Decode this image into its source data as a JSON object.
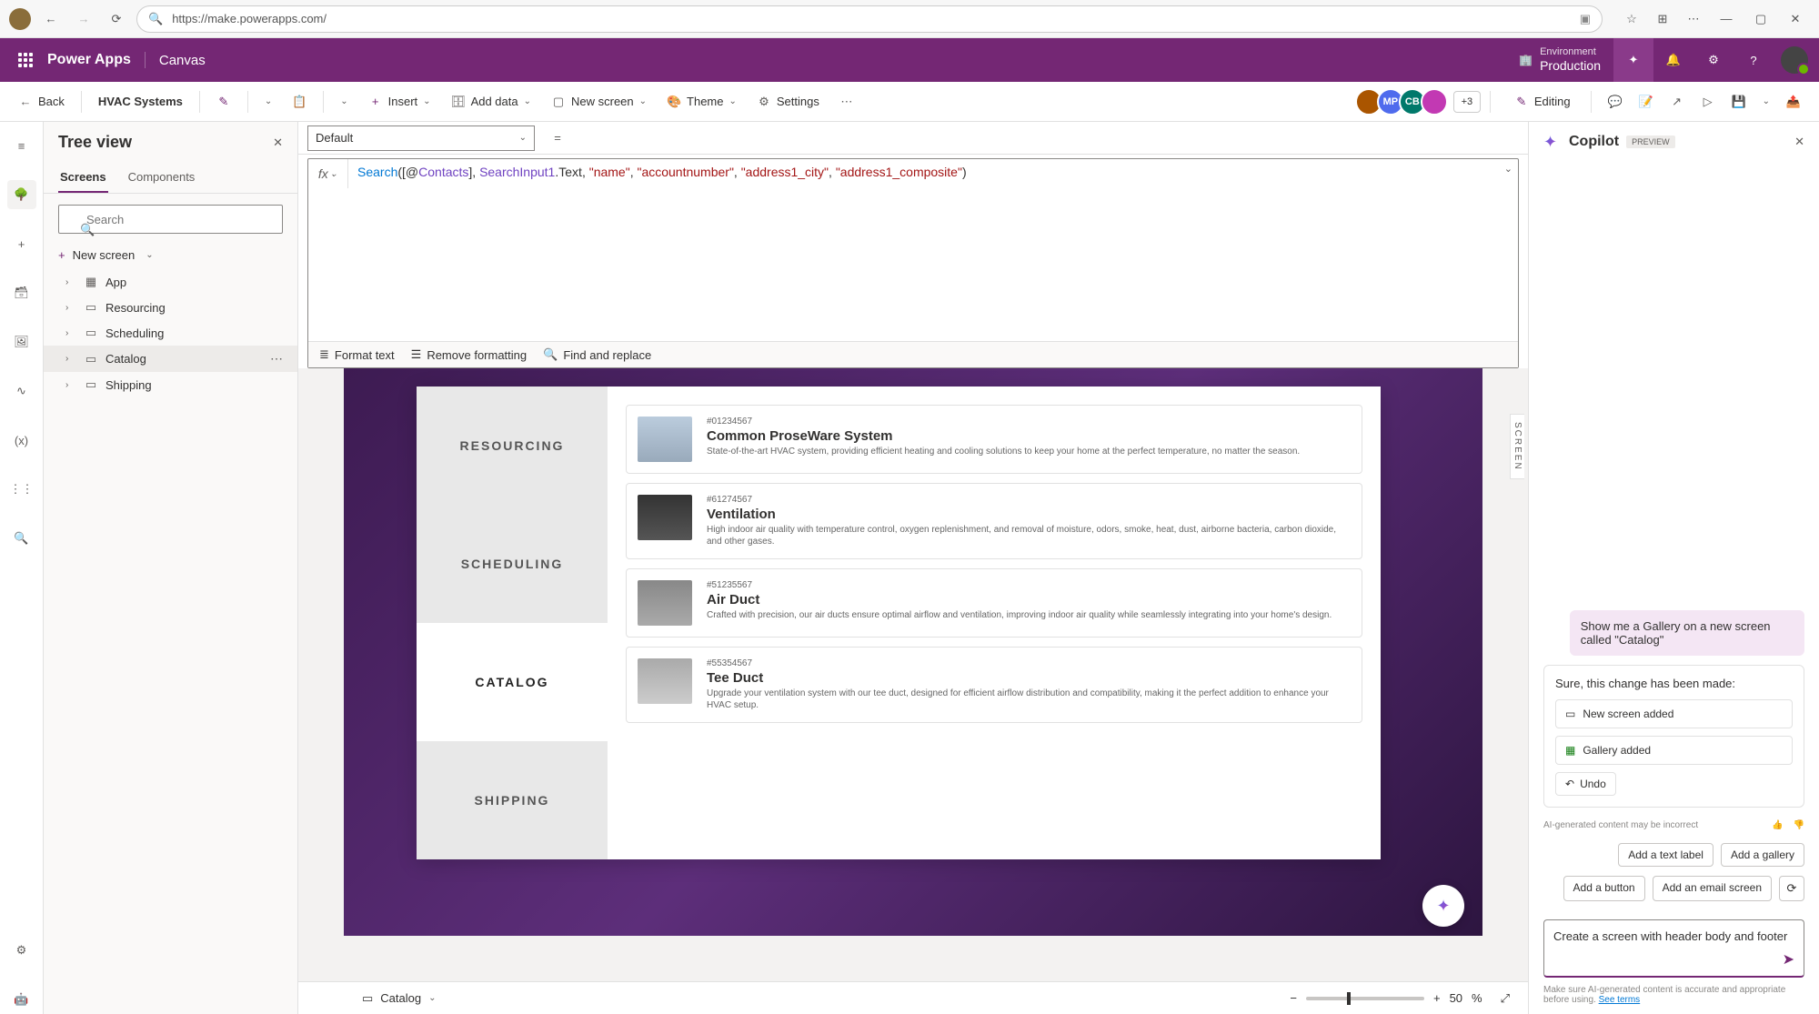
{
  "browser": {
    "url": "https://make.powerapps.com/"
  },
  "appbar": {
    "brand": "Power Apps",
    "sub": "Canvas",
    "env_label": "Environment",
    "env_value": "Production"
  },
  "cmdbar": {
    "back": "Back",
    "appname": "HVAC Systems",
    "insert": "Insert",
    "adddata": "Add data",
    "newscreen": "New screen",
    "theme": "Theme",
    "settings": "Settings",
    "more_users": "+3",
    "editing": "Editing"
  },
  "property": {
    "selected": "Default"
  },
  "formula": {
    "fn": "Search",
    "open_paren": "(",
    "arg1_open": "[@",
    "arg1_name": "Contacts",
    "arg1_close": "]",
    "comma1": ", ",
    "arg2_a": "SearchInput1",
    "arg2_b": ".Text",
    "comma2": ", ",
    "s1": "\"name\"",
    "comma3": ", ",
    "s2": "\"accountnumber\"",
    "comma4": ", ",
    "s3": "\"address1_city\"",
    "comma5": ", ",
    "s4": "\"address1_composite\"",
    "close_paren": ")"
  },
  "fxbar": {
    "format": "Format text",
    "remove": "Remove formatting",
    "find": "Find and replace"
  },
  "tree": {
    "title": "Tree view",
    "tab_screens": "Screens",
    "tab_components": "Components",
    "search_placeholder": "Search",
    "newscreen": "New screen",
    "items": [
      {
        "label": "App",
        "icon": "app"
      },
      {
        "label": "Resourcing",
        "icon": "screen"
      },
      {
        "label": "Scheduling",
        "icon": "screen"
      },
      {
        "label": "Catalog",
        "icon": "screen",
        "selected": true
      },
      {
        "label": "Shipping",
        "icon": "screen"
      }
    ]
  },
  "canvas": {
    "nav": [
      "RESOURCING",
      "SCHEDULING",
      "CATALOG",
      "SHIPPING"
    ],
    "catalog": [
      {
        "sku": "#01234567",
        "title": "Common ProseWare System",
        "desc": "State-of-the-art HVAC system, providing efficient heating and cooling solutions to keep your home at the perfect temperature, no matter the season."
      },
      {
        "sku": "#61274567",
        "title": "Ventilation",
        "desc": "High indoor air quality with temperature control, oxygen replenishment, and removal of moisture, odors, smoke, heat, dust, airborne bacteria, carbon dioxide, and other gases."
      },
      {
        "sku": "#51235567",
        "title": "Air Duct",
        "desc": "Crafted with precision, our air ducts ensure optimal airflow and ventilation, improving indoor air quality while seamlessly integrating into your home's design."
      },
      {
        "sku": "#55354567",
        "title": "Tee Duct",
        "desc": "Upgrade your ventilation system with our tee duct, designed for efficient airflow distribution and compatibility, making it the perfect addition to enhance your HVAC setup."
      }
    ],
    "screen_tab": "SCREEN"
  },
  "status": {
    "screen": "Catalog",
    "zoom": "50",
    "pct": "%"
  },
  "copilot": {
    "title": "Copilot",
    "badge": "PREVIEW",
    "user_msg": "Show me a Gallery on a new screen called \"Catalog\"",
    "bot_msg": "Sure, this change has been made:",
    "change1": "New screen added",
    "change2": "Gallery added",
    "undo": "Undo",
    "disclaimer": "AI-generated content may be incorrect",
    "suggestions": [
      "Add a text label",
      "Add a gallery",
      "Add a button",
      "Add an email screen"
    ],
    "input_text": "Create a screen with header body and footer",
    "footer_a": "Make sure AI-generated content is accurate and appropriate before using. ",
    "footer_link": "See terms"
  }
}
